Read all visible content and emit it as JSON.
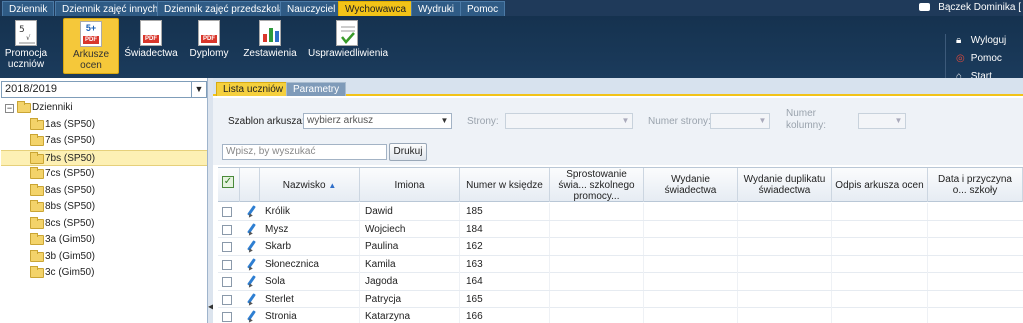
{
  "top_menu": {
    "tabs": [
      "Dziennik",
      "Dziennik zajęć innych",
      "Dziennik zajęć przedszkola",
      "Nauczyciel",
      "Wychowawca",
      "Wydruki",
      "Pomoc"
    ],
    "active_tab": "Wychowawca",
    "user": "Bączek Dominika ["
  },
  "toolbar": {
    "buttons": [
      {
        "label1": "Promocja",
        "label2": "uczniów",
        "icon": "promotion-icon"
      },
      {
        "label1": "Arkusze",
        "label2": "ocen",
        "icon": "pdf-grade-sheet-icon",
        "badge": "5+"
      },
      {
        "label1": "Świadectwa",
        "label2": "",
        "icon": "pdf-certificate-icon"
      },
      {
        "label1": "Dyplomy",
        "label2": "",
        "icon": "pdf-diploma-icon"
      },
      {
        "label1": "Zestawienia",
        "label2": "",
        "icon": "report-icon"
      },
      {
        "label1": "Usprawiedliwienia",
        "label2": "",
        "icon": "excuse-checklist-icon"
      }
    ],
    "active_button": "Arkusze ocen",
    "side_actions": [
      {
        "label": "Wyloguj",
        "icon": "lock-icon"
      },
      {
        "label": "Pomoc",
        "icon": "lifebuoy-icon"
      },
      {
        "label": "Start",
        "icon": "home-icon"
      }
    ]
  },
  "left_panel": {
    "school_year": "2018/2019",
    "tree": {
      "root": "Dzienniki",
      "items": [
        "1as (SP50)",
        "7as (SP50)",
        "7bs (SP50)",
        "7cs (SP50)",
        "8as (SP50)",
        "8bs (SP50)",
        "8cs (SP50)",
        "3a (Gim50)",
        "3b (Gim50)",
        "3c (Gim50)"
      ],
      "selected": "7bs (SP50)"
    }
  },
  "right_panel": {
    "tabs": [
      "Lista uczniów",
      "Parametry"
    ],
    "active_tab": "Lista uczniów",
    "form": {
      "template_label": "Szablon arkusza:",
      "template_value": "wybierz arkusz",
      "pages_label": "Strony:",
      "page_number_label": "Numer strony:",
      "column_number_label1": "Numer",
      "column_number_label2": "kolumny:"
    },
    "search_placeholder": "Wpisz, by wyszukać",
    "print_button": "Drukuj"
  },
  "grid": {
    "columns": [
      "Nazwisko",
      "Imiona",
      "Numer w księdze",
      "Sprostowanie świa... szkolnego promocy...",
      "Wydanie świadectwa",
      "Wydanie duplikatu świadectwa",
      "Odpis arkusza ocen",
      "Data i przyczyna o... szkoły"
    ],
    "sort_indicator": "▲",
    "rows": [
      {
        "surname": "Królik",
        "names": "Dawid",
        "number": "185"
      },
      {
        "surname": "Mysz",
        "names": "Wojciech",
        "number": "184"
      },
      {
        "surname": "Skarb",
        "names": "Paulina",
        "number": "162"
      },
      {
        "surname": "Słonecznica",
        "names": "Kamila",
        "number": "163"
      },
      {
        "surname": "Sola",
        "names": "Jagoda",
        "number": "164"
      },
      {
        "surname": "Sterlet",
        "names": "Patrycja",
        "number": "165"
      },
      {
        "surname": "Stronia",
        "names": "Katarzyna",
        "number": "166"
      }
    ]
  },
  "colors": {
    "menu_bar": "#1f3a5a",
    "accent_yellow": "#f2c318",
    "selection": "#fdf0b4"
  }
}
